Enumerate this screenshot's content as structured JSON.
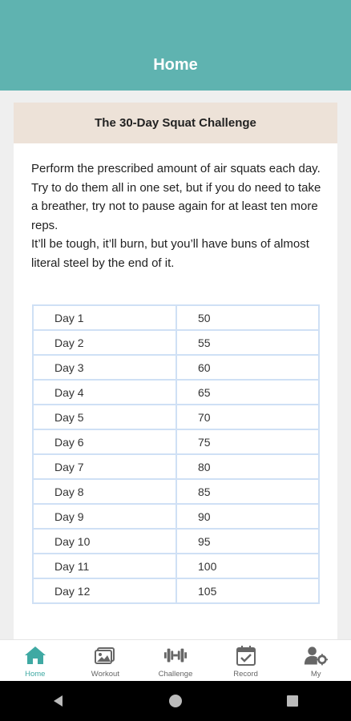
{
  "header": {
    "title": "Home"
  },
  "card": {
    "title": "The 30-Day Squat Challenge",
    "description": [
      " Perform the prescribed amount of air squats each day.",
      " Try to do them all in one set, but if you do need to take a breather, try not to pause again for at least ten more reps.",
      " It’ll be tough, it’ll burn, but you’ll have buns of almost literal steel by the end of it."
    ],
    "rows": [
      {
        "day": "Day 1",
        "reps": "50"
      },
      {
        "day": "Day 2",
        "reps": "55"
      },
      {
        "day": "Day 3",
        "reps": "60"
      },
      {
        "day": "Day 4",
        "reps": "65"
      },
      {
        "day": "Day 5",
        "reps": "70"
      },
      {
        "day": "Day 6",
        "reps": "75"
      },
      {
        "day": "Day 7",
        "reps": "80"
      },
      {
        "day": "Day 8",
        "reps": "85"
      },
      {
        "day": "Day 9",
        "reps": "90"
      },
      {
        "day": "Day 10",
        "reps": "95"
      },
      {
        "day": "Day 11",
        "reps": "100"
      },
      {
        "day": "Day 12",
        "reps": "105"
      }
    ]
  },
  "nav": {
    "items": [
      {
        "label": "Home",
        "icon": "home-icon",
        "active": true
      },
      {
        "label": "Workout",
        "icon": "image-icon",
        "active": false
      },
      {
        "label": "Challenge",
        "icon": "dumbbell-icon",
        "active": false
      },
      {
        "label": "Record",
        "icon": "calendar-check-icon",
        "active": false
      },
      {
        "label": "My",
        "icon": "user-gear-icon",
        "active": false
      }
    ]
  },
  "colors": {
    "header": "#5fb3b0",
    "card_header": "#ede2d8",
    "table_border": "#cfe0f5",
    "active_nav": "#3fa9a3"
  }
}
